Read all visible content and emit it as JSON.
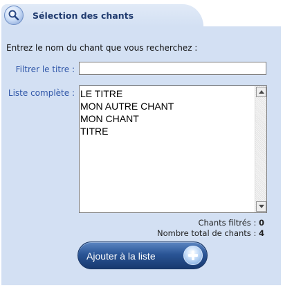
{
  "header": {
    "title": "Sélection des chants",
    "icon": "magnifier-icon"
  },
  "intro_text": "Entrez le nom du chant que vous recherchez :",
  "filter": {
    "label": "Filtrer le titre :",
    "value": ""
  },
  "list": {
    "label": "Liste complète :",
    "items": [
      "LE TITRE",
      "MON AUTRE CHANT",
      "MON CHANT",
      "TITRE"
    ]
  },
  "stats": {
    "filtered_label": "Chants filtrés :",
    "filtered_count": "0",
    "total_label": "Nombre total de chants :",
    "total_count": "4"
  },
  "add_button": {
    "label": "Ajouter à la liste",
    "icon": "plus-icon"
  },
  "colors": {
    "panel_bg": "#d3e0f3",
    "label_blue": "#2f56a8",
    "title_blue": "#1f3a6e",
    "button_blue": "#2a5596"
  }
}
